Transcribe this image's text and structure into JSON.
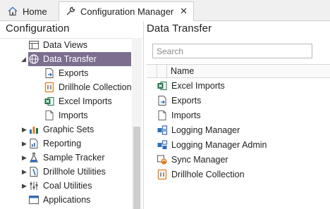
{
  "tabs": [
    {
      "label": "Home",
      "icon": "home-icon"
    },
    {
      "label": "Configuration Manager",
      "icon": "wrench-icon",
      "close": "✕"
    }
  ],
  "left": {
    "title": "Configuration",
    "tree": [
      {
        "label": "Data Views",
        "icon": "table-icon",
        "expander": ""
      },
      {
        "label": "Data Transfer",
        "icon": "globe-icon",
        "expander": "◢",
        "selected": true
      },
      {
        "label": "Exports",
        "icon": "export-icon",
        "expander": ""
      },
      {
        "label": "Drillhole Collection",
        "icon": "drillhole-collection-icon",
        "expander": ""
      },
      {
        "label": "Excel Imports",
        "icon": "excel-icon",
        "expander": ""
      },
      {
        "label": "Imports",
        "icon": "document-icon",
        "expander": ""
      },
      {
        "label": "Graphic Sets",
        "icon": "chart-icon",
        "expander": "▶"
      },
      {
        "label": "Reporting",
        "icon": "report-icon",
        "expander": "▶"
      },
      {
        "label": "Sample Tracker",
        "icon": "flask-icon",
        "expander": "▶"
      },
      {
        "label": "Drillhole Utilities",
        "icon": "drillhole-utilities-icon",
        "expander": "▶"
      },
      {
        "label": "Coal Utilities",
        "icon": "sliders-icon",
        "expander": "▶"
      },
      {
        "label": "Applications",
        "icon": "window-icon",
        "expander": ""
      }
    ]
  },
  "right": {
    "title": "Data Transfer",
    "search_placeholder": "Search",
    "column_name": "Name",
    "items": [
      {
        "label": "Excel Imports",
        "icon": "excel-icon"
      },
      {
        "label": "Exports",
        "icon": "export-icon"
      },
      {
        "label": "Imports",
        "icon": "document-icon"
      },
      {
        "label": "Logging Manager",
        "icon": "logging-icon"
      },
      {
        "label": "Logging Manager Admin",
        "icon": "logging-admin-icon"
      },
      {
        "label": "Sync Manager",
        "icon": "sync-icon"
      },
      {
        "label": "Drillhole Collection",
        "icon": "drillhole-collection-icon"
      }
    ]
  },
  "colors": {
    "selected_row": "#7c6e8f",
    "accent_blue": "#2f6fbf",
    "excel_green": "#1e7145",
    "orange": "#e07b1a"
  }
}
